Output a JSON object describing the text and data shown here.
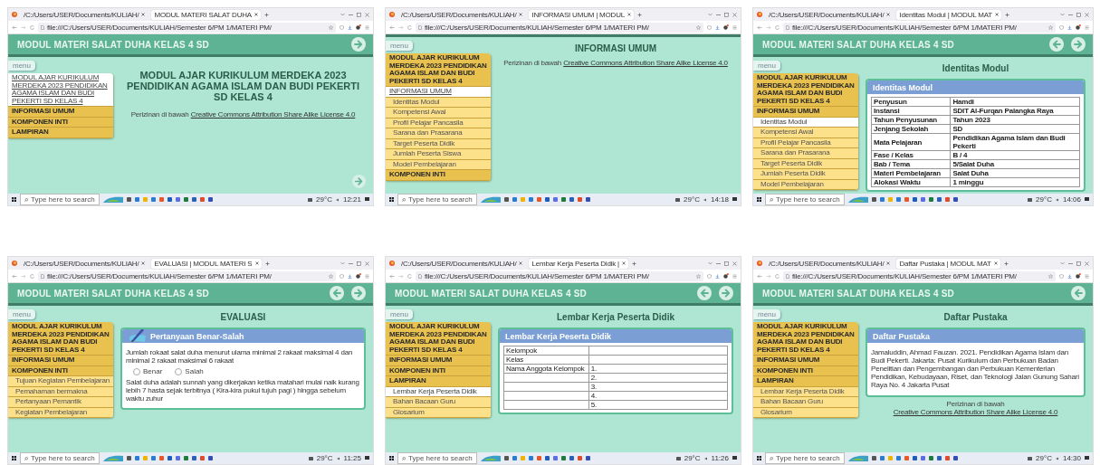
{
  "panels": [
    {
      "browser": {
        "tabs": [
          {
            "label": "/C:/Users/USER/Documents/KULIAH/",
            "selected": false
          },
          {
            "label": "MODUL MATERI SALAT DUHA",
            "selected": true
          }
        ],
        "address": "file:///C:/Users/USER/Documents/KULIAH/Semester 6/PM 1/MATERI PM/"
      },
      "page": {
        "header": {
          "title": "MODUL MATERI SALAT DUHA KELAS 4 SD",
          "prev_arrow": false,
          "next_arrow": true
        },
        "menu_button": "menu",
        "sidebar": [
          {
            "label": "MODUL AJAR KURIKULUM MERDEKA 2023 PENDIDIKAN AGAMA ISLAM DAN BUDI PEKERTI SD KELAS 4",
            "kind": "heading",
            "selected": true
          },
          {
            "label": "INFORMASI UMUM",
            "kind": "heading",
            "selected": false
          },
          {
            "label": "KOMPONEN INTI",
            "kind": "heading",
            "selected": false
          },
          {
            "label": "LAMPIRAN",
            "kind": "heading",
            "selected": false
          }
        ],
        "heading": "MODUL AJAR KURIKULUM MERDEKA 2023 PENDIDIKAN AGAMA ISLAM DAN BUDI PEKERTI SD KELAS 4",
        "license": {
          "prefix": "Perizinan di bawah",
          "link": "Creative Commons Attribution Share Alike License 4.0"
        },
        "corner_next_arrow": true
      },
      "taskbar": {
        "search_placeholder": "Type here to search",
        "temperature": "29°C",
        "time": "12:21"
      }
    },
    {
      "browser": {
        "tabs": [
          {
            "label": "/C:/Users/USER/Documents/KULIAH/",
            "selected": false
          },
          {
            "label": "INFORMASI UMUM | MODUL",
            "selected": true
          }
        ],
        "address": "file:///C:/Users/USER/Documents/KULIAH/Semester 6/PM 1/MATERI PM/"
      },
      "page": {
        "menu_button": "menu",
        "sidebar": [
          {
            "label": "MODUL AJAR KURIKULUM MERDEKA 2023 PENDIDIKAN AGAMA ISLAM DAN BUDI PEKERTI SD KELAS 4",
            "kind": "heading",
            "selected": false
          },
          {
            "label": "INFORMASI UMUM",
            "kind": "heading",
            "selected": true
          },
          {
            "label": "Identitas Modul",
            "kind": "subitem",
            "selected": false
          },
          {
            "label": "Kompetensi Awal",
            "kind": "subitem",
            "selected": false
          },
          {
            "label": "Profil Pelajar Pancasila",
            "kind": "subitem",
            "selected": false
          },
          {
            "label": "Sarana dan Prasarana",
            "kind": "subitem",
            "selected": false
          },
          {
            "label": "Target Peserta Didik",
            "kind": "subitem",
            "selected": false
          },
          {
            "label": "Jumlah Peserta Siswa",
            "kind": "subitem",
            "selected": false
          },
          {
            "label": "Model Pembelajaran",
            "kind": "subitem",
            "selected": false
          },
          {
            "label": "KOMPONEN INTI",
            "kind": "heading",
            "selected": false
          }
        ],
        "heading": "INFORMASI UMUM",
        "license": {
          "prefix": "Perizinan di bawah",
          "link": "Creative Commons Attribution Share Alike License 4.0"
        }
      },
      "taskbar": {
        "search_placeholder": "Type here to search",
        "temperature": "29°C",
        "time": "14:18"
      }
    },
    {
      "browser": {
        "tabs": [
          {
            "label": "/C:/Users/USER/Documents/KULIAH/",
            "selected": false
          },
          {
            "label": "Identitas Modul | MODUL MAT",
            "selected": true
          }
        ],
        "address": "file:///C:/Users/USER/Documents/KULIAH/Semester 6/PM 1/MATERI PM/"
      },
      "page": {
        "header": {
          "title": "MODUL MATERI SALAT DUHA KELAS 4 SD",
          "prev_arrow": true,
          "next_arrow": true
        },
        "menu_button": "menu",
        "sidebar": [
          {
            "label": "MODUL AJAR KURIKULUM MERDEKA 2023 PENDIDIKAN AGAMA ISLAM DAN BUDI PEKERTI SD KELAS 4",
            "kind": "heading",
            "selected": false
          },
          {
            "label": "INFORMASI UMUM",
            "kind": "heading",
            "selected": false
          },
          {
            "label": "Identitas Modul",
            "kind": "subitem",
            "selected": true
          },
          {
            "label": "Kompetensi Awal",
            "kind": "subitem",
            "selected": false
          },
          {
            "label": "Profil Pelajar Pancasila",
            "kind": "subitem",
            "selected": false
          },
          {
            "label": "Sarana dan Prasarana",
            "kind": "subitem",
            "selected": false
          },
          {
            "label": "Target Peserta Didik",
            "kind": "subitem",
            "selected": false
          },
          {
            "label": "Jumlah Peserta Didik",
            "kind": "subitem",
            "selected": false
          },
          {
            "label": "Model Pembelajaran",
            "kind": "subitem",
            "selected": false
          }
        ],
        "heading": "Identitas Modul",
        "card": {
          "title": "Identitas Modul",
          "kind": "table",
          "bold": true,
          "rows": [
            [
              {
                "text": "Penyusun"
              },
              {
                "text": "Hamdi"
              }
            ],
            [
              {
                "text": "Instansi"
              },
              {
                "text": "SDIT Al-Furqan Palangka Raya"
              }
            ],
            [
              {
                "text": "Tahun Penyusunan"
              },
              {
                "text": "Tahun 2023"
              }
            ],
            [
              {
                "text": "Jenjang Sekolah"
              },
              {
                "text": "SD"
              }
            ],
            [
              {
                "text": "Mata Pelajaran"
              },
              {
                "text": "Pendidikan Agama Islam dan Budi Pekerti"
              }
            ],
            [
              {
                "text": "Fase / Kelas"
              },
              {
                "text": "B / 4"
              }
            ],
            [
              {
                "text": "Bab / Tema"
              },
              {
                "text": "5/Salat Duha"
              }
            ],
            [
              {
                "text": "Materi Pembelajaran"
              },
              {
                "text": "Salat Duha"
              }
            ],
            [
              {
                "text": "Alokasi Waktu"
              },
              {
                "text": "1 minggu"
              }
            ]
          ]
        }
      },
      "taskbar": {
        "search_placeholder": "Type here to search",
        "temperature": "29°C",
        "time": "14:06"
      }
    },
    {
      "browser": {
        "tabs": [
          {
            "label": "/C:/Users/USER/Documents/KULIAH/",
            "selected": false
          },
          {
            "label": "EVALUASI | MODUL MATERI S",
            "selected": true
          }
        ],
        "address": "file:///C:/Users/USER/Documents/KULIAH/Semester 6/PM 1/MATERI PM/"
      },
      "page": {
        "header": {
          "title": "MODUL MATERI SALAT DUHA KELAS 4 SD",
          "prev_arrow": true,
          "next_arrow": true
        },
        "menu_button": "menu",
        "sidebar": [
          {
            "label": "MODUL AJAR KURIKULUM MERDEKA 2023 PENDIDIKAN AGAMA ISLAM DAN BUDI PEKERTI SD KELAS 4",
            "kind": "heading",
            "selected": false
          },
          {
            "label": "INFORMASI UMUM",
            "kind": "heading",
            "selected": false
          },
          {
            "label": "KOMPONEN INTI",
            "kind": "heading",
            "selected": false
          },
          {
            "label": "Tujuan Kegiatan Pembelajaran",
            "kind": "subitem",
            "selected": false
          },
          {
            "label": "Pemahaman bermakna",
            "kind": "subitem",
            "selected": false
          },
          {
            "label": "Pertanyaan Pemantik",
            "kind": "subitem",
            "selected": false
          },
          {
            "label": "Kegiatan Pembelajaran",
            "kind": "subitem",
            "selected": false
          }
        ],
        "heading": "EVALUASI",
        "card": {
          "title": "Pertanyaan Benar-Salah",
          "kind": "quiz",
          "questions": [
            {
              "text": "Jumlah rokaat salat duha menurut ulama minimal 2 rakaat maksimal 4 dan minimal 2 rakaat maksimal 6 rakaat",
              "options": [
                {
                  "label": "Benar",
                  "selected": false
                },
                {
                  "label": "Salah",
                  "selected": false
                }
              ]
            },
            {
              "text": "Salat duha adalah sunnah yang dikerjakan ketika matahari mulai naik kurang lebih 7 hasta sejak terbitnya ( Kira-kira pukul tujuh pagi ) hingga sebelum waktu zuhur"
            }
          ]
        }
      },
      "taskbar": {
        "search_placeholder": "Type here to search",
        "temperature": "29°C",
        "time": "11:25"
      }
    },
    {
      "browser": {
        "tabs": [
          {
            "label": "/C:/Users/USER/Documents/KULIAH/",
            "selected": false
          },
          {
            "label": "Lembar Kerja Peserta Didik |",
            "selected": true
          }
        ],
        "address": "file:///C:/Users/USER/Documents/KULIAH/Semester 6/PM 1/MATERI PM/"
      },
      "page": {
        "header": {
          "title": "MODUL MATERI SALAT DUHA KELAS 4 SD",
          "prev_arrow": true,
          "next_arrow": true
        },
        "menu_button": "menu",
        "sidebar": [
          {
            "label": "MODUL AJAR KURIKULUM MERDEKA 2023 PENDIDIKAN AGAMA ISLAM DAN BUDI PEKERTI SD KELAS 4",
            "kind": "heading",
            "selected": false
          },
          {
            "label": "INFORMASI UMUM",
            "kind": "heading",
            "selected": false
          },
          {
            "label": "KOMPONEN INTI",
            "kind": "heading",
            "selected": false
          },
          {
            "label": "LAMPIRAN",
            "kind": "heading",
            "selected": false
          },
          {
            "label": "Lembar Kerja Peserta Didik",
            "kind": "subitem",
            "selected": true
          },
          {
            "label": "Bahan Bacaan Guru",
            "kind": "subitem",
            "selected": false
          },
          {
            "label": "Glosarium",
            "kind": "subitem",
            "selected": false
          }
        ],
        "heading": "Lembar Kerja Peserta Didik",
        "card": {
          "title": "Lembar Kerja Peserta Didik",
          "kind": "table",
          "bold": false,
          "rows": [
            [
              {
                "text": "Kelompok"
              },
              {}
            ],
            [
              {
                "text": "Kelas"
              },
              {}
            ],
            [
              {
                "text": "Nama Anggota Kelompok"
              },
              {
                "text": "1."
              }
            ],
            [
              {},
              {
                "text": "2."
              }
            ],
            [
              {},
              {
                "text": "3."
              }
            ],
            [
              {},
              {
                "text": "4."
              }
            ],
            [
              {},
              {
                "text": "5."
              }
            ]
          ]
        }
      },
      "taskbar": {
        "search_placeholder": "Type here to search",
        "temperature": "29°C",
        "time": "11:26"
      }
    },
    {
      "browser": {
        "tabs": [
          {
            "label": "/C:/Users/USER/Documents/KULIAH/",
            "selected": false
          },
          {
            "label": "Daftar Pustaka | MODUL MAT",
            "selected": true
          }
        ],
        "address": "file:///C:/Users/USER/Documents/KULIAH/Semester 6/PM 1/MATERI PM/"
      },
      "page": {
        "header": {
          "title": "MODUL MATERI SALAT DUHA KELAS 4 SD",
          "prev_arrow": true,
          "next_arrow": false
        },
        "menu_button": "menu",
        "sidebar": [
          {
            "label": "MODUL AJAR KURIKULUM MERDEKA 2023 PENDIDIKAN AGAMA ISLAM DAN BUDI PEKERTI SD KELAS 4",
            "kind": "heading",
            "selected": false
          },
          {
            "label": "INFORMASI UMUM",
            "kind": "heading",
            "selected": false
          },
          {
            "label": "KOMPONEN INTI",
            "kind": "heading",
            "selected": false
          },
          {
            "label": "LAMPIRAN",
            "kind": "heading",
            "selected": false
          },
          {
            "label": "Lembar Kerja Peserta Didik",
            "kind": "subitem",
            "selected": false
          },
          {
            "label": "Bahan Bacaan Guru",
            "kind": "subitem",
            "selected": false
          },
          {
            "label": "Glosarium",
            "kind": "subitem",
            "selected": false
          }
        ],
        "heading": "Daftar Pustaka",
        "card": {
          "title": "Daftar Pustaka",
          "kind": "text",
          "text": "Jamaluddin, Ahmad Fauzan. 2021. Pendidikan Agama Islam dan Budi Pekerti. Jakarta: Pusat Kurikulum dan Perbukuan Badan Penelitian dan Pengembangan dan Perbukuan Kementerian Pendidikan, Kebudayaan, Riset, dan Teknologi Jalan Gunung Sahari Raya No. 4 Jakarta Pusat"
        },
        "license": {
          "prefix": "Perizinan di bawah",
          "link": "Creative Commons Attribution Share Alike License 4.0"
        }
      },
      "taskbar": {
        "search_placeholder": "Type here to search",
        "temperature": "29°C",
        "time": "14:30"
      }
    }
  ]
}
